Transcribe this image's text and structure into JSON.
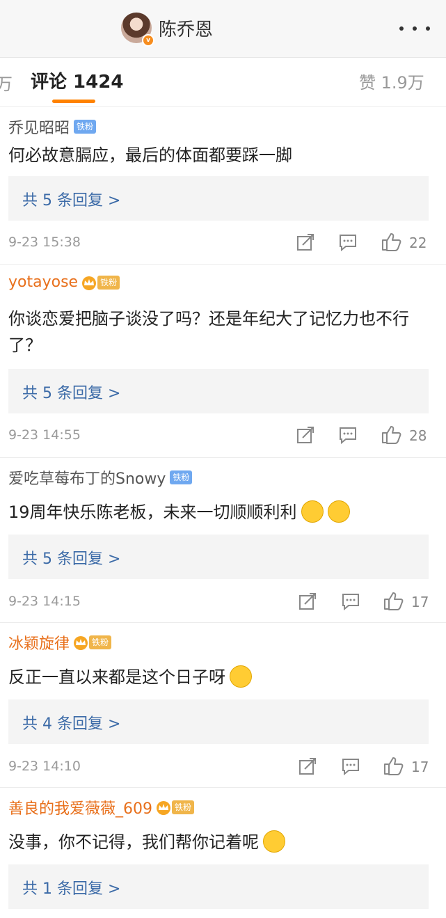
{
  "header": {
    "username": "陈乔恩"
  },
  "tabs": {
    "left_partial": "万",
    "comments": "评论 1424",
    "likes": "赞 1.9万"
  },
  "comments": [
    {
      "user": "乔见昭昭",
      "badge": "铁粉",
      "text": "何必故意膈应，最后的体面都要踩一脚",
      "replies": "共 5 条回复 >",
      "time": "9-23 15:38",
      "likes": "22"
    },
    {
      "user": "yotayose",
      "badge": "铁粉",
      "text": "你谈恋爱把脑子谈没了吗？还是年纪大了记忆力也不行了？",
      "replies": "共 5 条回复 >",
      "time": "9-23 14:55",
      "likes": "28"
    },
    {
      "user": "爱吃草莓布丁的Snowy",
      "badge": "铁粉",
      "text": "19周年快乐陈老板，未来一切顺顺利利",
      "replies": "共 5 条回复 >",
      "time": "9-23 14:15",
      "likes": "17"
    },
    {
      "user": "冰颖旋律",
      "badge": "铁粉",
      "text": "反正一直以来都是这个日子呀",
      "replies": "共 4 条回复 >",
      "time": "9-23 14:10",
      "likes": "17"
    },
    {
      "user": "善良的我爱薇薇_609",
      "badge": "铁粉",
      "text": "没事，你不记得，我们帮你记着呢",
      "replies": "共 1 条回复 >"
    }
  ],
  "icons": {
    "share": "share-icon",
    "comment": "comment-icon",
    "like": "thumbs-up-icon",
    "more": "more-icon",
    "verified": "verified-badge-icon",
    "crown": "crown-icon"
  },
  "colors": {
    "accent": "#ff8200",
    "link": "#3b6aa7",
    "username_orange": "#e8701c"
  }
}
